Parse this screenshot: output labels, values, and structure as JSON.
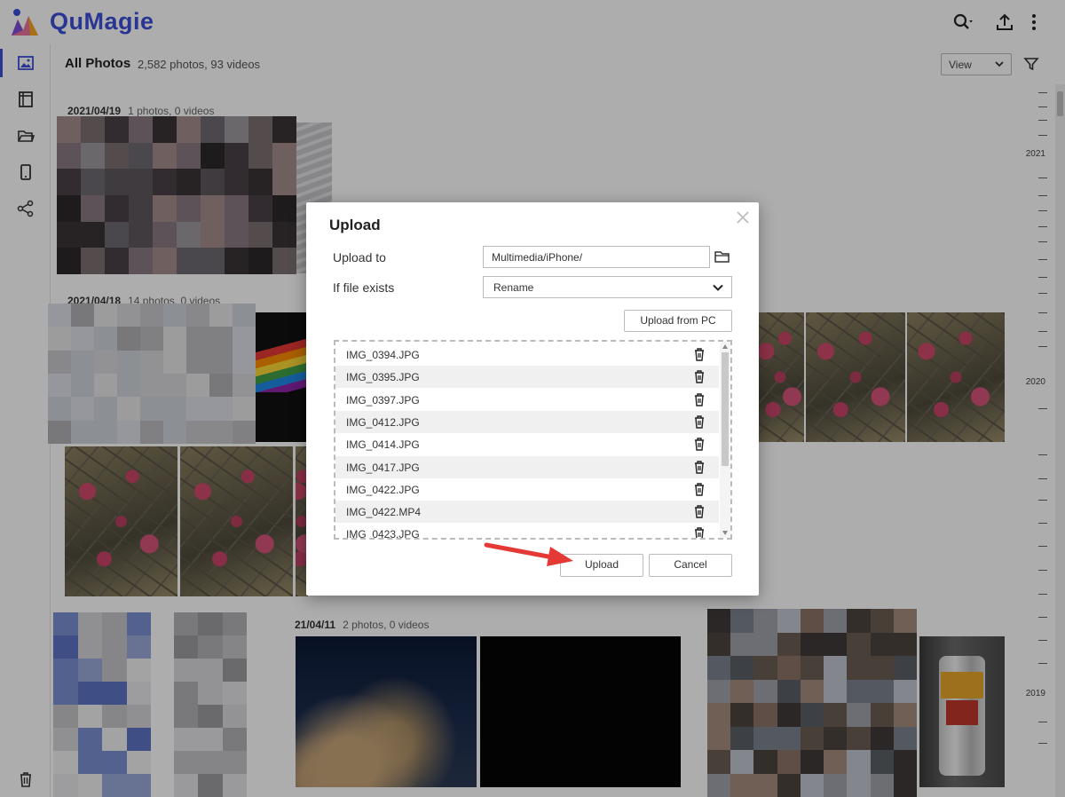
{
  "app": {
    "name": "QuMagie",
    "brand_color": "#3b4ed8"
  },
  "header": {
    "title": "All Photos",
    "count": "2,582 photos, 93 videos",
    "view_label": "View"
  },
  "topbar_icons": [
    "search-icon",
    "upload-icon",
    "more-vertical-icon"
  ],
  "sidebar": {
    "items": [
      {
        "name": "photos",
        "icon": "image-icon",
        "active": true
      },
      {
        "name": "albums",
        "icon": "album-icon",
        "active": false
      },
      {
        "name": "folders",
        "icon": "folder-icon",
        "active": false
      },
      {
        "name": "devices",
        "icon": "phone-icon",
        "active": false
      },
      {
        "name": "shared",
        "icon": "share-icon",
        "active": false
      }
    ],
    "trash_icon": "trash-icon"
  },
  "gallery": {
    "groups": [
      {
        "date": "2021/04/19",
        "count": "1 photos, 0 videos"
      },
      {
        "date": "2021/04/18",
        "count": "14 photos, 0 videos"
      },
      {
        "date": "21/04/11",
        "count": "2 photos, 0 videos"
      }
    ]
  },
  "timeline": {
    "years": [
      "2021",
      "2020",
      "2019"
    ]
  },
  "dialog": {
    "title": "Upload",
    "upload_to_label": "Upload to",
    "upload_to_value": "Multimedia/iPhone/",
    "if_exists_label": "If file exists",
    "if_exists_value": "Rename",
    "upload_from_pc": "Upload from PC",
    "files": [
      "IMG_0394.JPG",
      "IMG_0395.JPG",
      "IMG_0397.JPG",
      "IMG_0412.JPG",
      "IMG_0414.JPG",
      "IMG_0417.JPG",
      "IMG_0422.JPG",
      "IMG_0422.MP4",
      "IMG_0423.JPG"
    ],
    "upload_button": "Upload",
    "cancel_button": "Cancel"
  }
}
